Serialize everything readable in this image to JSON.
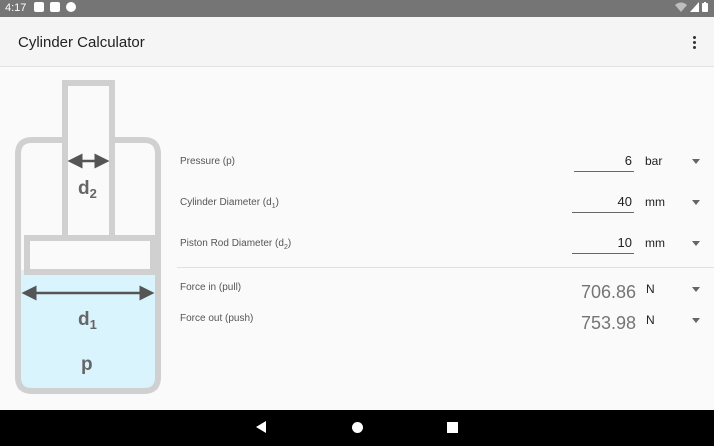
{
  "status": {
    "time": "4:17"
  },
  "app": {
    "title": "Cylinder Calculator"
  },
  "diagram": {
    "label_d2": "d",
    "label_d2_sub": "2",
    "label_d1": "d",
    "label_d1_sub": "1",
    "label_p": "p"
  },
  "inputs": [
    {
      "label": "Pressure (p)",
      "value": "6",
      "unit": "bar"
    },
    {
      "label": "Cylinder Diameter (d",
      "sub": "1",
      "suffix": ")",
      "value": "40",
      "unit": "mm"
    },
    {
      "label": "Piston Rod Diameter (d",
      "sub": "2",
      "suffix": ")",
      "value": "10",
      "unit": "mm"
    }
  ],
  "outputs": [
    {
      "label": "Force in (pull)",
      "value": "706.86",
      "unit": "N"
    },
    {
      "label": "Force out (push)",
      "value": "753.98",
      "unit": "N"
    }
  ]
}
